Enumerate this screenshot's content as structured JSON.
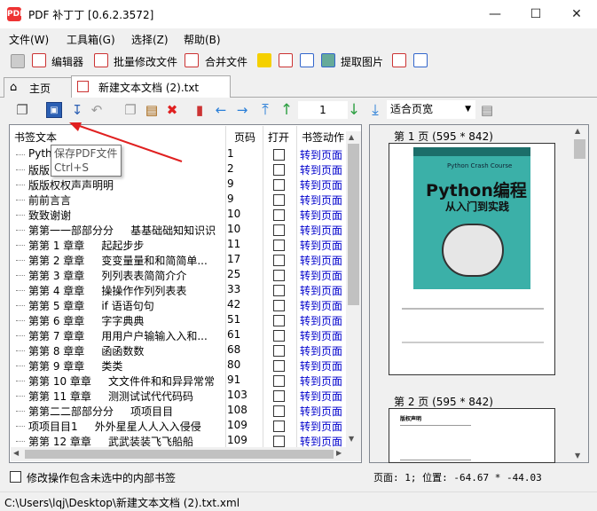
{
  "window": {
    "title": "PDF 补丁丁 [0.6.2.3572]",
    "app_icon_text": "PDF"
  },
  "menu": [
    "文件(W)",
    "工具箱(G)",
    "选择(Z)",
    "帮助(B)"
  ],
  "toolbar1": [
    "编辑器",
    "批量修改文件",
    "合并文件",
    "提取图片"
  ],
  "tabs": [
    "主页",
    "新建文本文档 (2).txt"
  ],
  "toolbar2": {
    "page": "1",
    "zoom": "适合页宽"
  },
  "tooltip": {
    "line1": "保存PDF文件",
    "line2": "Ctrl+S"
  },
  "bookmarks": {
    "headers": {
      "text": "书签文本",
      "page": "页码",
      "open": "打开",
      "action": "书签动作"
    },
    "action_label": "转到页面",
    "rows": [
      {
        "text": "Pyth",
        "page": "1"
      },
      {
        "text": "版版",
        "page": "2"
      },
      {
        "text": "版版权权声声明明",
        "page": "9"
      },
      {
        "text": "前前言言",
        "page": "9"
      },
      {
        "text": "致致谢谢",
        "page": "10"
      },
      {
        "text": "第第一一部部分分     基基础础知知识识",
        "page": "10"
      },
      {
        "text": "第第 1 章章     起起步步",
        "page": "11"
      },
      {
        "text": "第第 2 章章     变变量量和和简简单...",
        "page": "17"
      },
      {
        "text": "第第 3 章章     列列表表简简介介",
        "page": "25"
      },
      {
        "text": "第第 4 章章     操操作作列列表表",
        "page": "33"
      },
      {
        "text": "第第 5 章章     if 语语句句",
        "page": "42"
      },
      {
        "text": "第第 6 章章     字字典典",
        "page": "51"
      },
      {
        "text": "第第 7 章章     用用户户输输入入和...",
        "page": "61"
      },
      {
        "text": "第第 8 章章     函函数数",
        "page": "68"
      },
      {
        "text": "第第 9 章章     类类",
        "page": "80"
      },
      {
        "text": "第第 10 章章     文文件件和和异异常常",
        "page": "91"
      },
      {
        "text": "第第 11 章章     测测试试代代码码",
        "page": "103"
      },
      {
        "text": "第第二二部部分分     项项目目",
        "page": "108"
      },
      {
        "text": "项项目目1     外外星星人人入入侵侵",
        "page": "109"
      },
      {
        "text": "第第 12 章章     武武装装飞飞船船",
        "page": "109"
      }
    ]
  },
  "inner_checkbox_label": "修改操作包含未选中的内部书签",
  "preview": {
    "page1_title": "第 1 页 (595 * 842)",
    "page2_title": "第 2 页 (595 * 842)",
    "cover_title": "Python编程",
    "cover_subtitle": "从入门到实践",
    "cover_en": "Python Crash Course",
    "page2_heading": "版权声明",
    "position": "页面: 1; 位置: -64.67 * -44.03"
  },
  "status": "C:\\Users\\lqj\\Desktop\\新建文本文档 (2).txt.xml",
  "colors": {
    "link": "#0000cc",
    "arrow": "#e02020",
    "cover_bg": "#3bb0a8"
  }
}
